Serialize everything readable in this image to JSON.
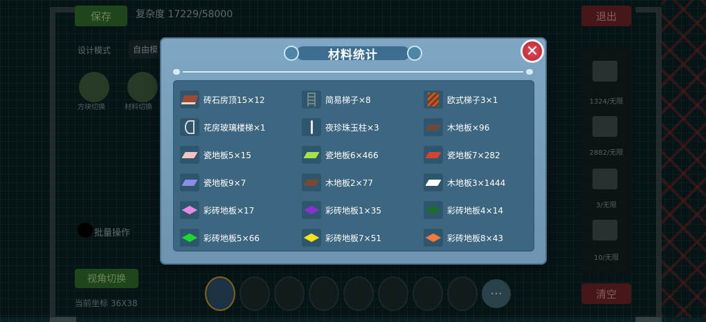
{
  "background": {
    "save_label": "保存",
    "complexity_label": "复杂度 17229/58000",
    "exit_label": "退出",
    "mode_label": "设计模式",
    "mode_value": "自由模",
    "tool1_label": "方块切换",
    "tool2_label": "材料切换",
    "batch_label": "批量操作",
    "switch_label": "视角切换",
    "coords_label": "当前坐标 36X38",
    "clear_label": "清空",
    "side_items": [
      "1324/无限",
      "2882/无限",
      "3/无限",
      "10/无限"
    ],
    "more_label": "···"
  },
  "dialog": {
    "title": "材料统计",
    "close_icon": "close-icon"
  },
  "materials": [
    {
      "label": "砖石房顶15×12",
      "icon": "roof",
      "color": "#a04a32"
    },
    {
      "label": "简易梯子×8",
      "icon": "ladder",
      "color": "#6e8c84"
    },
    {
      "label": "欧式梯子3×1",
      "icon": "stairs",
      "color": "#b85a2a"
    },
    {
      "label": "花房玻璃楼梯×1",
      "icon": "spiral-stairs",
      "color": "#d8d8d8"
    },
    {
      "label": "夜珍珠玉柱×3",
      "icon": "pillar",
      "color": "#e8e8e8"
    },
    {
      "label": "木地板×96",
      "icon": "wood-floor",
      "color": "#6b4a3c"
    },
    {
      "label": "瓷地板5×15",
      "icon": "tile",
      "color": "#f2c4c0"
    },
    {
      "label": "瓷地板6×466",
      "icon": "tile",
      "color": "#a6e04a"
    },
    {
      "label": "瓷地板7×282",
      "icon": "tile",
      "color": "#d2452e"
    },
    {
      "label": "瓷地板9×7",
      "icon": "tile",
      "color": "#8a8ee6"
    },
    {
      "label": "木地板2×77",
      "icon": "wood-floor",
      "color": "#7a4a2e"
    },
    {
      "label": "木地板3×1444",
      "icon": "tile",
      "color": "#ffffff"
    },
    {
      "label": "彩砖地板×17",
      "icon": "diamond",
      "color": "#e58be0"
    },
    {
      "label": "彩砖地板1×35",
      "icon": "diamond",
      "color": "#8a2fd0"
    },
    {
      "label": "彩砖地板4×14",
      "icon": "diamond",
      "color": "#1f6b2a"
    },
    {
      "label": "彩砖地板5×66",
      "icon": "diamond",
      "color": "#1fd62a"
    },
    {
      "label": "彩砖地板7×51",
      "icon": "diamond",
      "color": "#f2e21a"
    },
    {
      "label": "彩砖地板8×43",
      "icon": "diamond",
      "color": "#f27a3a"
    }
  ]
}
